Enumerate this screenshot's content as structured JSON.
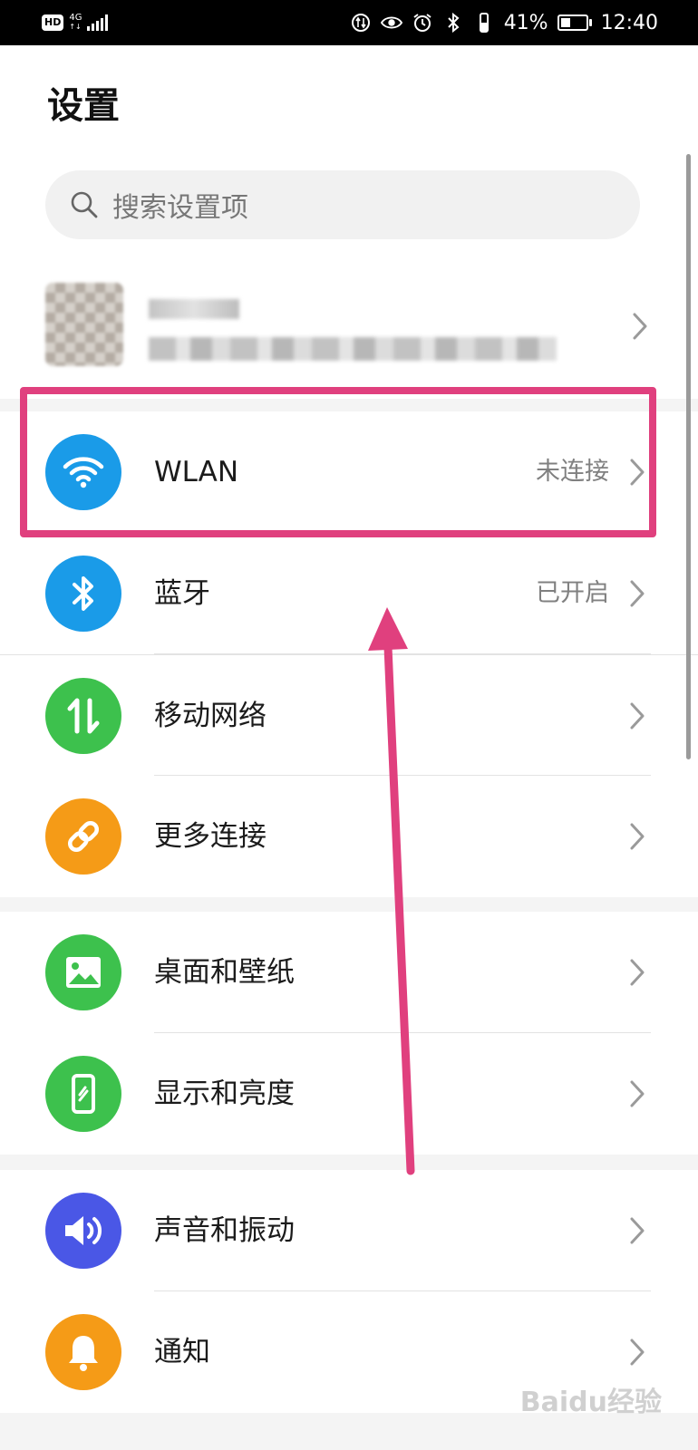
{
  "status_bar": {
    "hd": "HD",
    "network": "4G",
    "battery_percent": "41%",
    "battery_level": 0.41,
    "time": "12:40"
  },
  "page_title": "设置",
  "search": {
    "placeholder": "搜索设置项",
    "icon": "search-icon"
  },
  "account": {
    "icon": "avatar"
  },
  "groups": [
    {
      "items": [
        {
          "label": "WLAN",
          "status": "未连接",
          "icon": "wifi-icon",
          "color": "#1a9be8"
        },
        {
          "label": "蓝牙",
          "status": "已开启",
          "icon": "bluetooth-icon",
          "color": "#1a9be8"
        },
        {
          "label": "移动网络",
          "status": "",
          "icon": "mobile-data-icon",
          "color": "#3dc14d"
        },
        {
          "label": "更多连接",
          "status": "",
          "icon": "link-icon",
          "color": "#f59b17"
        }
      ]
    },
    {
      "items": [
        {
          "label": "桌面和壁纸",
          "status": "",
          "icon": "wallpaper-icon",
          "color": "#3dc14d"
        },
        {
          "label": "显示和亮度",
          "status": "",
          "icon": "display-icon",
          "color": "#3dc14d"
        }
      ]
    },
    {
      "items": [
        {
          "label": "声音和振动",
          "status": "",
          "icon": "sound-icon",
          "color": "#4a57e6"
        },
        {
          "label": "通知",
          "status": "",
          "icon": "notification-icon",
          "color": "#f59b17"
        }
      ]
    }
  ],
  "annotation": {
    "highlight_color": "#e0407e"
  },
  "watermark": "Baidu经验"
}
